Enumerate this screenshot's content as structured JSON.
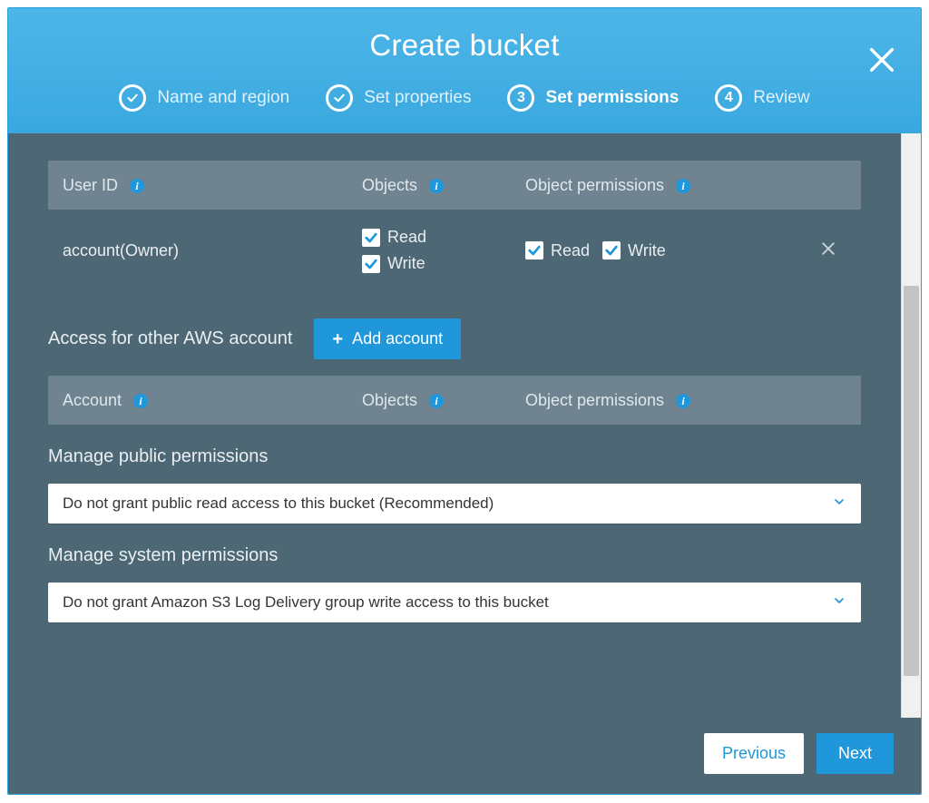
{
  "title": "Create bucket",
  "steps": [
    {
      "label": "Name and region",
      "state": "done"
    },
    {
      "label": "Set properties",
      "state": "done"
    },
    {
      "label": "Set permissions",
      "state": "active",
      "num": "3"
    },
    {
      "label": "Review",
      "state": "pending",
      "num": "4"
    }
  ],
  "userTable": {
    "headers": {
      "user": "User ID",
      "objects": "Objects",
      "perms": "Object permissions"
    },
    "row": {
      "user": "account(Owner)",
      "objects": {
        "read": "Read",
        "write": "Write",
        "readChecked": true,
        "writeChecked": true
      },
      "perms": {
        "read": "Read",
        "write": "Write",
        "readChecked": true,
        "writeChecked": true
      }
    }
  },
  "otherAccounts": {
    "title": "Access for other AWS account",
    "addLabel": "Add account",
    "headers": {
      "account": "Account",
      "objects": "Objects",
      "perms": "Object permissions"
    }
  },
  "publicPerms": {
    "title": "Manage public permissions",
    "value": "Do not grant public read access to this bucket (Recommended)"
  },
  "systemPerms": {
    "title": "Manage system permissions",
    "value": "Do not grant Amazon S3 Log Delivery group write access to this bucket"
  },
  "footer": {
    "prev": "Previous",
    "next": "Next"
  }
}
